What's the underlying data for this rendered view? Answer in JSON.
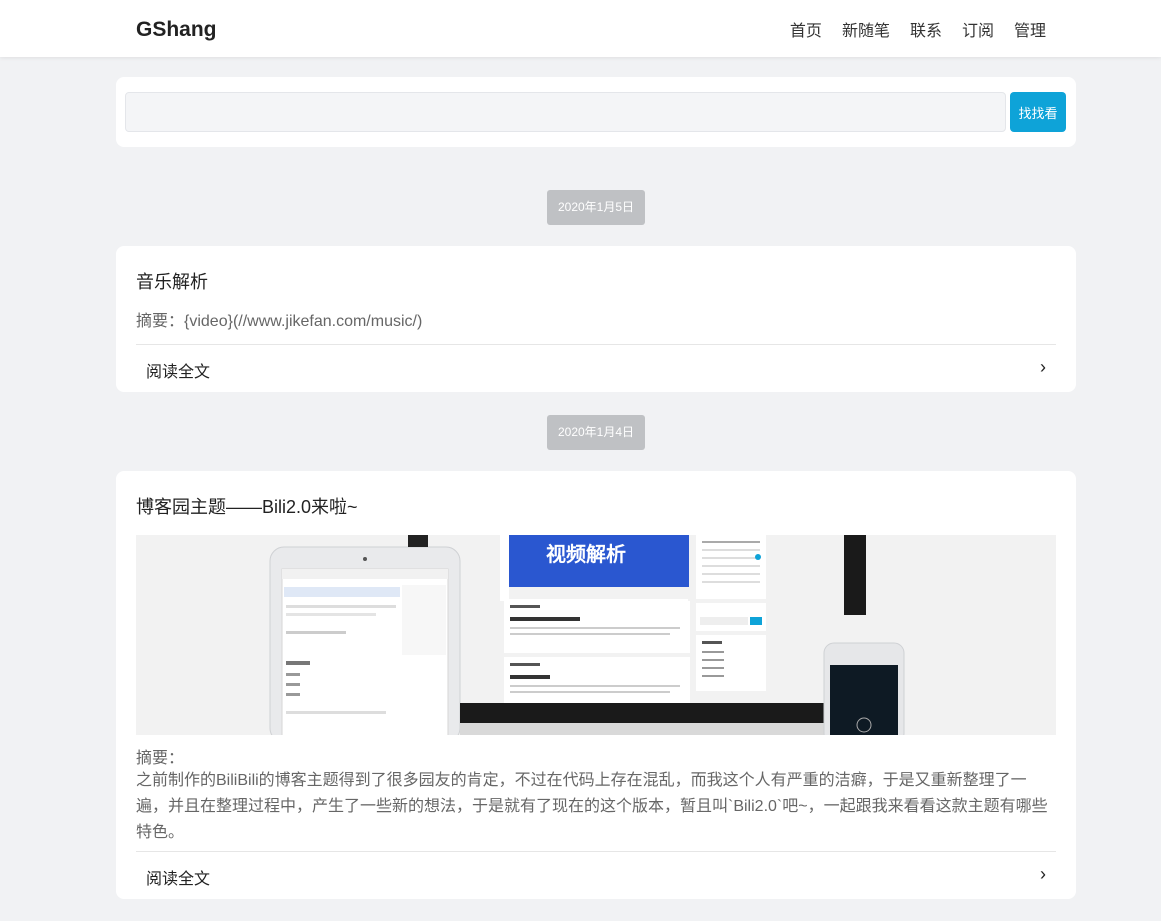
{
  "header": {
    "brand": "GShang",
    "nav": [
      "首页",
      "新随笔",
      "联系",
      "订阅",
      "管理"
    ]
  },
  "search": {
    "value": "",
    "placeholder": "",
    "button": "找找看"
  },
  "posts": [
    {
      "date": "2020年1月5日",
      "title": "音乐解析",
      "summary": "摘要：{video}(//www.jikefan.com/music/)",
      "read_more": "阅读全文",
      "chevron": "›"
    },
    {
      "date": "2020年1月4日",
      "title": "博客园主题——Bili2.0来啦~",
      "summary_label": "摘要：",
      "summary": "之前制作的BiliBili的博客主题得到了很多园友的肯定，不过在代码上存在混乱，而我这个人有严重的洁癖，于是又重新整理了一遍，并且在整理过程中，产生了一些新的想法，于是就有了现在的这个版本，暂且叫`Bili2.0`吧~，一起跟我来看看这款主题有哪些特色。",
      "read_more": "阅读全文",
      "chevron": "›",
      "thumbnail": {
        "banner_text": "视频解析"
      }
    }
  ],
  "colors": {
    "accent": "#0ea3d8",
    "page_bg": "#f1f2f4",
    "badge_bg": "#bfc1c4"
  }
}
